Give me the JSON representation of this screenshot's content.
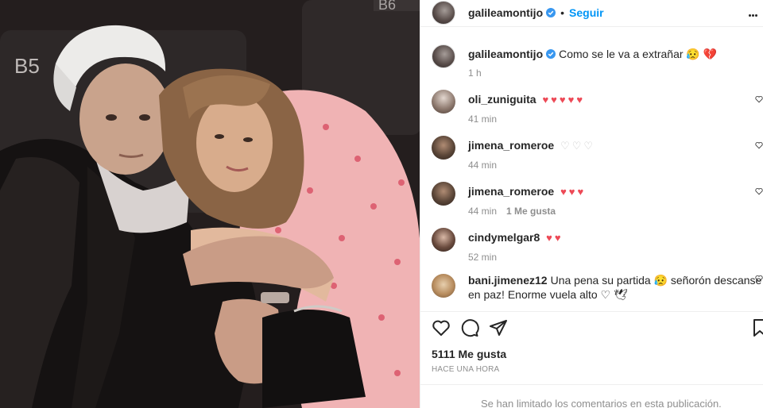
{
  "post": {
    "author": "galileamontijo",
    "follow_label": "Seguir",
    "caption": {
      "user": "galileamontijo",
      "text": "Como se le va a extrañar 😥 💔",
      "time": "1 h"
    },
    "comments": [
      {
        "user": "oli_zuniguita",
        "text": "♥ ♥ ♥ ♥ ♥",
        "hearts": "red",
        "time": "41 min",
        "likes": ""
      },
      {
        "user": "jimena_romeroe",
        "text": "♡ ♡ ♡",
        "hearts": "white",
        "time": "44 min",
        "likes": ""
      },
      {
        "user": "jimena_romeroe",
        "text": "♥ ♥ ♥",
        "hearts": "red",
        "time": "44 min",
        "likes": "1 Me gusta"
      },
      {
        "user": "cindymelgar8",
        "text": "♥ ♥",
        "hearts": "red",
        "time": "52 min",
        "likes": ""
      },
      {
        "user": "bani.jimenez12",
        "text": "Una pena su partida 😥 señorón descanse en paz! Enorme vuela alto ♡ 🕊",
        "hearts": "none",
        "time": "",
        "likes": ""
      }
    ],
    "likes_count": "5111 Me gusta",
    "posted_ago": "HACE UNA HORA",
    "comments_limited": "Se han limitado los comentarios en esta publicación."
  },
  "photo": {
    "seat_labels": [
      "B5",
      "B6"
    ]
  },
  "icons": {
    "like": "heart-outline-icon",
    "comment": "comment-bubble-icon",
    "share": "paper-plane-icon",
    "save": "bookmark-icon",
    "verified": "verified-badge-icon",
    "more": "more-options-icon"
  },
  "colors": {
    "accent": "#0095f6",
    "heart": "#ed4956",
    "verified": "#3897f0",
    "muted": "#8e8e8e"
  }
}
